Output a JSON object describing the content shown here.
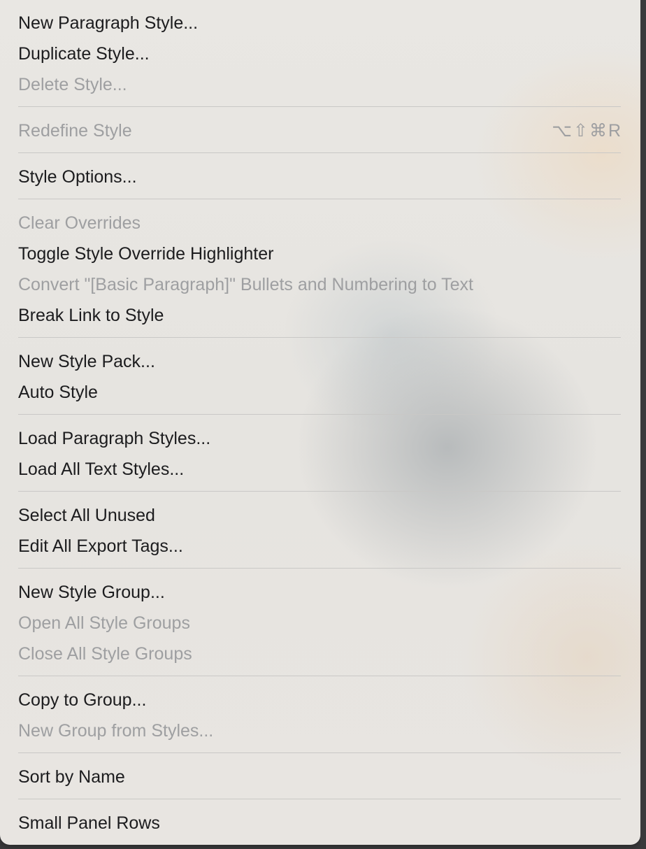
{
  "menu": {
    "items": [
      {
        "label": "New Paragraph Style...",
        "enabled": true
      },
      {
        "label": "Duplicate Style...",
        "enabled": true
      },
      {
        "label": "Delete Style...",
        "enabled": false
      },
      {
        "label": "Redefine Style",
        "enabled": false,
        "shortcut": "⌥⇧⌘R"
      },
      {
        "label": "Style Options...",
        "enabled": true
      },
      {
        "label": "Clear Overrides",
        "enabled": false
      },
      {
        "label": "Toggle Style Override Highlighter",
        "enabled": true
      },
      {
        "label": "Convert \"[Basic Paragraph]\" Bullets and Numbering to Text",
        "enabled": false
      },
      {
        "label": "Break Link to Style",
        "enabled": true
      },
      {
        "label": "New Style Pack...",
        "enabled": true
      },
      {
        "label": "Auto Style",
        "enabled": true
      },
      {
        "label": "Load Paragraph Styles...",
        "enabled": true
      },
      {
        "label": "Load All Text Styles...",
        "enabled": true
      },
      {
        "label": "Select All Unused",
        "enabled": true
      },
      {
        "label": "Edit All Export Tags...",
        "enabled": true
      },
      {
        "label": "New Style Group...",
        "enabled": true
      },
      {
        "label": "Open All Style Groups",
        "enabled": false
      },
      {
        "label": "Close All Style Groups",
        "enabled": false
      },
      {
        "label": "Copy to Group...",
        "enabled": true
      },
      {
        "label": "New Group from Styles...",
        "enabled": false
      },
      {
        "label": "Sort by Name",
        "enabled": true
      },
      {
        "label": "Small Panel Rows",
        "enabled": true
      }
    ]
  },
  "colors": {
    "text_enabled": "#1c1c1e",
    "text_disabled": "#9e9fa1",
    "separator": "#c9c8c6"
  }
}
